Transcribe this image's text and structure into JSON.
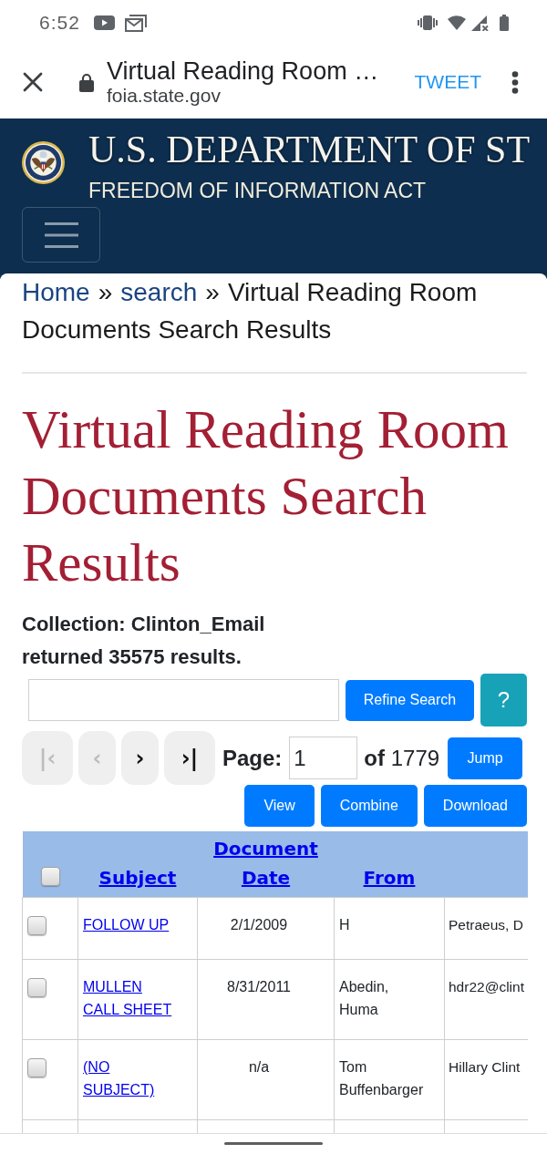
{
  "status_bar": {
    "time": "6:52"
  },
  "browser_bar": {
    "title": "Virtual Reading Room …",
    "url": "foia.state.gov",
    "action": "TWEET"
  },
  "site_header": {
    "agency": "U.S. DEPARTMENT OF ST",
    "subtitle": "FREEDOM OF INFORMATION ACT"
  },
  "breadcrumb": [
    {
      "kind": "link",
      "label": "Home"
    },
    {
      "kind": "separator",
      "label": "»"
    },
    {
      "kind": "link",
      "label": "search"
    },
    {
      "kind": "separator",
      "label": "»"
    },
    {
      "kind": "current",
      "label": "Virtual Reading Room Documents Search Results"
    }
  ],
  "heading": "Virtual Reading Room Documents Search Results",
  "collection": "Collection: Clinton_Email",
  "result_count": "returned 35575 results.",
  "search": {
    "button": "Refine Search",
    "help": "?"
  },
  "pagination": {
    "buttons": [
      {
        "label": "|‹",
        "disabled": true
      },
      {
        "label": "‹",
        "disabled": true
      },
      {
        "label": "›",
        "disabled": false
      },
      {
        "label": "›|",
        "disabled": false
      }
    ],
    "page_label": "Page:",
    "page": "1",
    "page_count": "**of** 1779",
    "jump": "Jump"
  },
  "actions": [
    "View",
    "Combine",
    "Download"
  ],
  "table": {
    "select_all": {
      "checked": false
    },
    "columns": [
      "Subject",
      "Document Date",
      "From"
    ],
    "rows": [
      {
        "checked": false,
        "subject": "FOLLOW UP",
        "document_date": "2/1/2009",
        "from": "H",
        "column_5": "Petraeus, D"
      },
      {
        "checked": false,
        "subject": "MULLEN CALL SHEET",
        "document_date": "8/31/2011",
        "from": "Abedin, Huma",
        "column_5": "hdr22@clint"
      },
      {
        "checked": false,
        "subject": "(NO SUBJECT)",
        "document_date": "n/a",
        "from": "Tom Buffenbarger",
        "column_5": "Hillary Clint"
      }
    ]
  }
}
